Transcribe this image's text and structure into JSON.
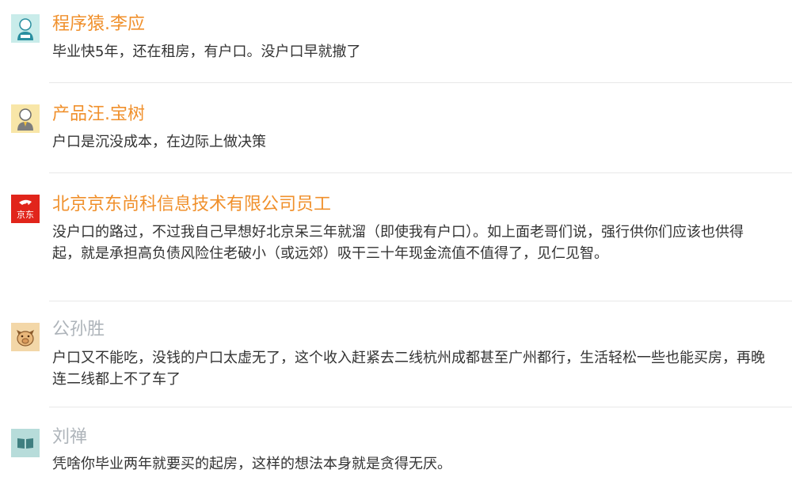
{
  "colors": {
    "name_highlight": "#f0902c",
    "name_muted": "#aeb4ba",
    "body_text": "#333333",
    "divider": "#e8e8e8"
  },
  "comments": [
    {
      "name": "程序猿.李应",
      "text": "毕业快5年，还在租房，有户口。没户口早就撤了",
      "avatar_icon": "programmer-avatar-icon",
      "name_style": "highlight"
    },
    {
      "name": "产品汪.宝树",
      "text": "户口是沉没成本，在边际上做决策",
      "avatar_icon": "product-manager-avatar-icon",
      "name_style": "highlight"
    },
    {
      "name": "北京京东尚科信息技术有限公司员工",
      "text": "没户口的路过，不过我自己早想好北京呆三年就溜（即使我有户口）。如上面老哥们说，强行供你们应该也供得起，就是承担高负债风险住老破小（或远郊）吸干三十年现金流值不值得了，见仁见智。",
      "avatar_icon": "jd-logo-icon",
      "avatar_label": "京东",
      "name_style": "highlight"
    },
    {
      "name": "公孙胜",
      "text": "户口又不能吃，没钱的户口太虚无了，这个收入赶紧去二线杭州成都甚至广州都行，生活轻松一些也能买房，再晚连二线都上不了车了",
      "avatar_icon": "pig-avatar-icon",
      "name_style": "muted"
    },
    {
      "name": "刘禅",
      "text": "凭啥你毕业两年就要买的起房，这样的想法本身就是贪得无厌。",
      "avatar_icon": "book-avatar-icon",
      "name_style": "muted"
    }
  ]
}
